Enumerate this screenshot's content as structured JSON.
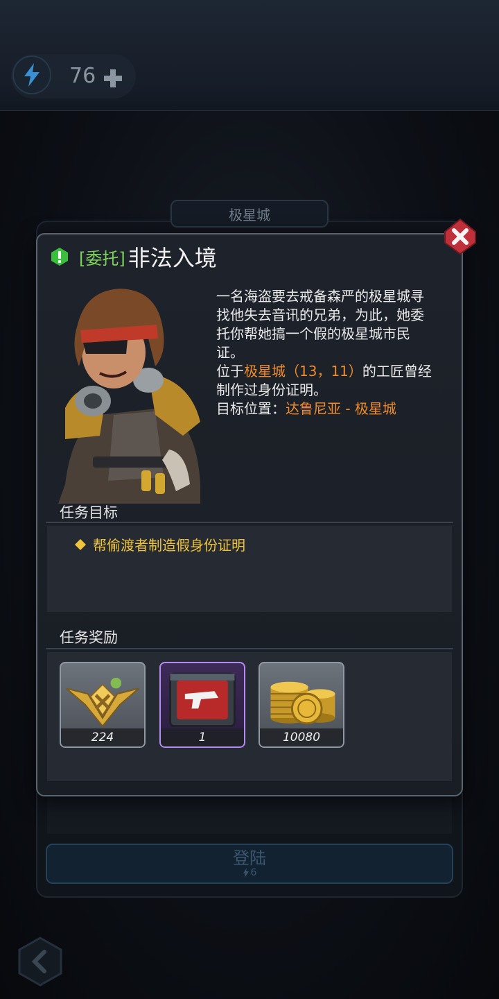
{
  "top_bar": {
    "energy_value": "76",
    "energy_icon": "lightning-icon",
    "add_icon": "plus-icon"
  },
  "location_tab": {
    "label": "极星城"
  },
  "dialog": {
    "title_tag": "[委托]",
    "title": "非法入境",
    "description_lines": [
      "一名海盗要去戒备森严的极星城寻",
      "找他失去音讯的兄弟，为此，她委",
      "托你帮她搞一个假的极星城市民",
      "证。"
    ],
    "location_prefix": "位于",
    "location_name": "极星城（13，11）",
    "location_suffix": "的工匠曾经",
    "location_line2": "制作过身份证明。",
    "target_label": "目标位置：",
    "target_value": "达鲁尼亚 - 极星城",
    "objectives_heading": "任务目标",
    "objectives": [
      {
        "text": "帮偷渡者制造假身份证明"
      }
    ],
    "rewards_heading": "任务奖励",
    "rewards": [
      {
        "icon": "rank-badge-icon",
        "count": "224",
        "rarity": "common"
      },
      {
        "icon": "weapon-crate-icon",
        "count": "1",
        "rarity": "epic"
      },
      {
        "icon": "gold-coins-icon",
        "count": "10080",
        "rarity": "common"
      }
    ]
  },
  "login_button": {
    "label": "登陆",
    "cost": "6"
  },
  "colors": {
    "accent_orange": "#f08a2c",
    "tag_green": "#7dd35a",
    "objective_gold": "#f0c43a",
    "close_red": "#c0303a"
  }
}
